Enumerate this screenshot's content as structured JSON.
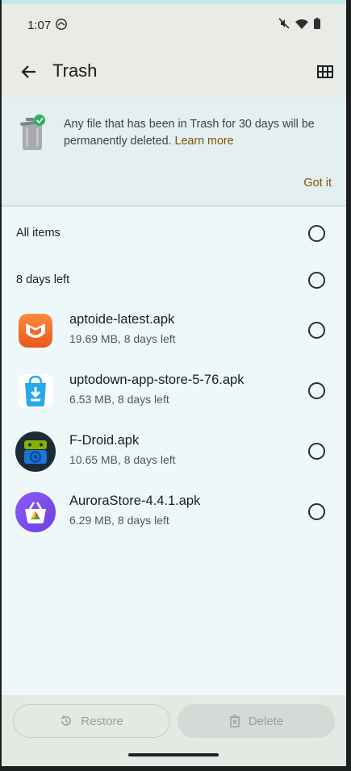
{
  "status": {
    "time": "1:07"
  },
  "header": {
    "title": "Trash"
  },
  "banner": {
    "text": "Any file that has been in Trash for 30 days will be permanently deleted.",
    "link": "Learn more",
    "dismiss": "Got it"
  },
  "sections": {
    "all_items": "All items",
    "group": "8 days left"
  },
  "files": [
    {
      "name": "aptoide-latest.apk",
      "meta": "19.69 MB, 8 days left",
      "icon": "aptoide-icon"
    },
    {
      "name": "uptodown-app-store-5-76.apk",
      "meta": "6.53 MB, 8 days left",
      "icon": "uptodown-icon"
    },
    {
      "name": "F-Droid.apk",
      "meta": "10.65 MB, 8 days left",
      "icon": "fdroid-icon"
    },
    {
      "name": "AuroraStore-4.4.1.apk",
      "meta": "6.29 MB, 8 days left",
      "icon": "aurora-store-icon"
    }
  ],
  "actions": {
    "restore": "Restore",
    "delete": "Delete"
  }
}
